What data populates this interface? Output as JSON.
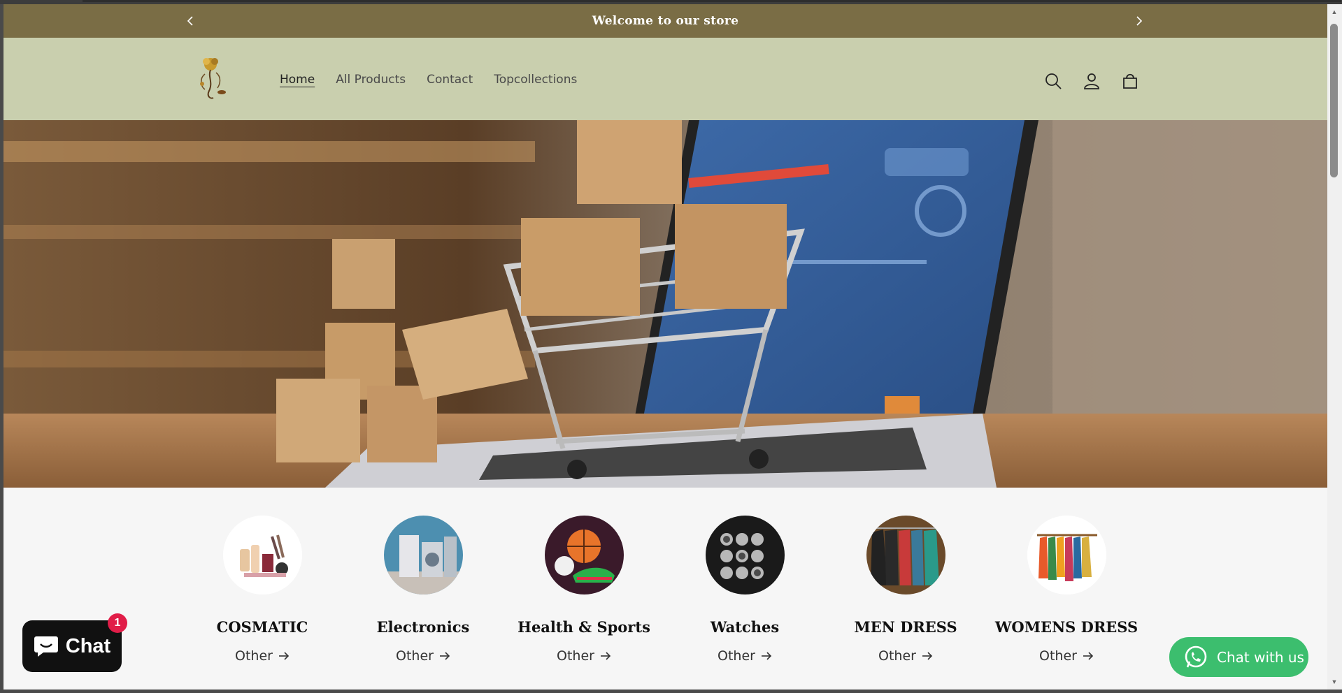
{
  "announcement": {
    "message": "Welcome to our store",
    "prev_icon": "chevron-left-icon",
    "next_icon": "chevron-right-icon"
  },
  "header": {
    "nav": [
      {
        "label": "Home",
        "active": true
      },
      {
        "label": "All Products",
        "active": false
      },
      {
        "label": "Contact",
        "active": false
      },
      {
        "label": "Topcollections",
        "active": false
      }
    ],
    "icons": [
      "search-icon",
      "account-icon",
      "cart-icon"
    ]
  },
  "collections": [
    {
      "title": "COSMATIC",
      "link": "Other"
    },
    {
      "title": "Electronics",
      "link": "Other"
    },
    {
      "title": "Health & Sports",
      "link": "Other"
    },
    {
      "title": "Watches",
      "link": "Other"
    },
    {
      "title": "MEN DRESS",
      "link": "Other"
    },
    {
      "title": "WOMENS DRESS",
      "link": "Other"
    }
  ],
  "shop_chat": {
    "label": "Chat",
    "badge": "1"
  },
  "whatsapp_chat": {
    "label": "Chat with us"
  },
  "colors": {
    "announcement_bg": "#7a6d45",
    "header_bg": "#c9cfae",
    "whatsapp_green": "#3cbe6e",
    "badge_red": "#e11d48"
  }
}
